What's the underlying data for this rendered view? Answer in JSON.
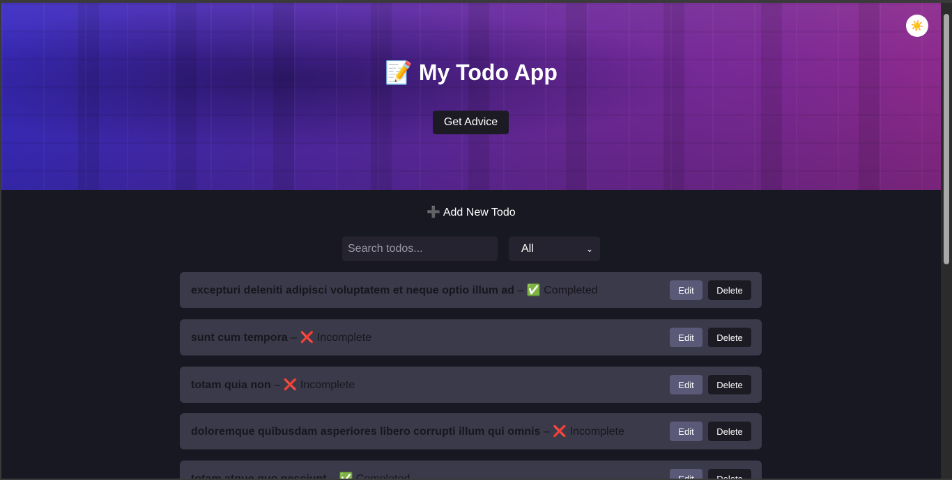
{
  "header": {
    "title": "📝 My Todo App",
    "advice_label": "Get Advice",
    "theme_icon": "☀️"
  },
  "add_todo_label": "➕ Add New Todo",
  "search": {
    "placeholder": "Search todos...",
    "value": ""
  },
  "filter": {
    "selected": "All"
  },
  "todos": [
    {
      "title": "excepturi deleniti adipisci voluptatem et neque optio illum ad",
      "status": "✅ Completed",
      "edit": "Edit",
      "delete": "Delete"
    },
    {
      "title": "sunt cum tempora",
      "status": "❌ Incomplete",
      "edit": "Edit",
      "delete": "Delete"
    },
    {
      "title": "totam quia non",
      "status": "❌ Incomplete",
      "edit": "Edit",
      "delete": "Delete"
    },
    {
      "title": "doloremque quibusdam asperiores libero corrupti illum qui omnis",
      "status": "❌ Incomplete",
      "edit": "Edit",
      "delete": "Delete"
    },
    {
      "title": "totam atque quo nesciunt",
      "status": "✅ Completed",
      "edit": "Edit",
      "delete": "Delete"
    }
  ],
  "separator": " – ",
  "colors": {
    "accent_start": "#3b2cc2",
    "accent_end": "#8d2a8e",
    "background": "#181822",
    "card": "#3b3a4a"
  }
}
